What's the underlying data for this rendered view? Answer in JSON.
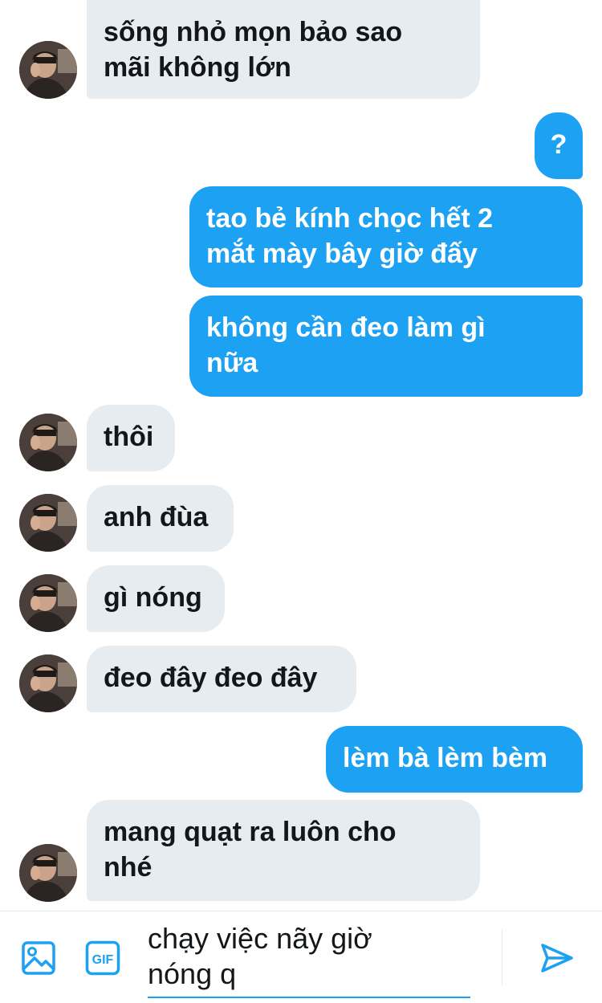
{
  "conversation": {
    "messages": [
      {
        "id": "m1",
        "sender": "other",
        "text": "sống nhỏ mọn bảo sao\nmãi không lớn"
      },
      {
        "id": "m2",
        "sender": "me",
        "text": "?"
      },
      {
        "id": "m3",
        "sender": "me",
        "text": "tao bẻ kính chọc hết 2\nmắt mày bây giờ đấy"
      },
      {
        "id": "m4",
        "sender": "me",
        "text": "không cần đeo làm gì\nnữa"
      },
      {
        "id": "m5",
        "sender": "other",
        "text": "thôi"
      },
      {
        "id": "m6",
        "sender": "other",
        "text": "anh đùa"
      },
      {
        "id": "m7",
        "sender": "other",
        "text": "gì nóng"
      },
      {
        "id": "m8",
        "sender": "other",
        "text": "đeo đây đeo đây"
      },
      {
        "id": "m9",
        "sender": "me",
        "text": "lèm bà lèm bèm"
      },
      {
        "id": "m10",
        "sender": "other",
        "text": "mang quạt ra luôn cho\nnhé"
      }
    ]
  },
  "composer": {
    "draft": "chạy việc nãy giờ\nnóng q",
    "media_icon": "image-icon",
    "gif_icon": "gif-icon",
    "gif_label": "GIF",
    "send_icon": "send-icon"
  },
  "colors": {
    "outgoing_bubble": "#1da1f2",
    "incoming_bubble": "#e6ecf0",
    "accent": "#1da1f2"
  }
}
